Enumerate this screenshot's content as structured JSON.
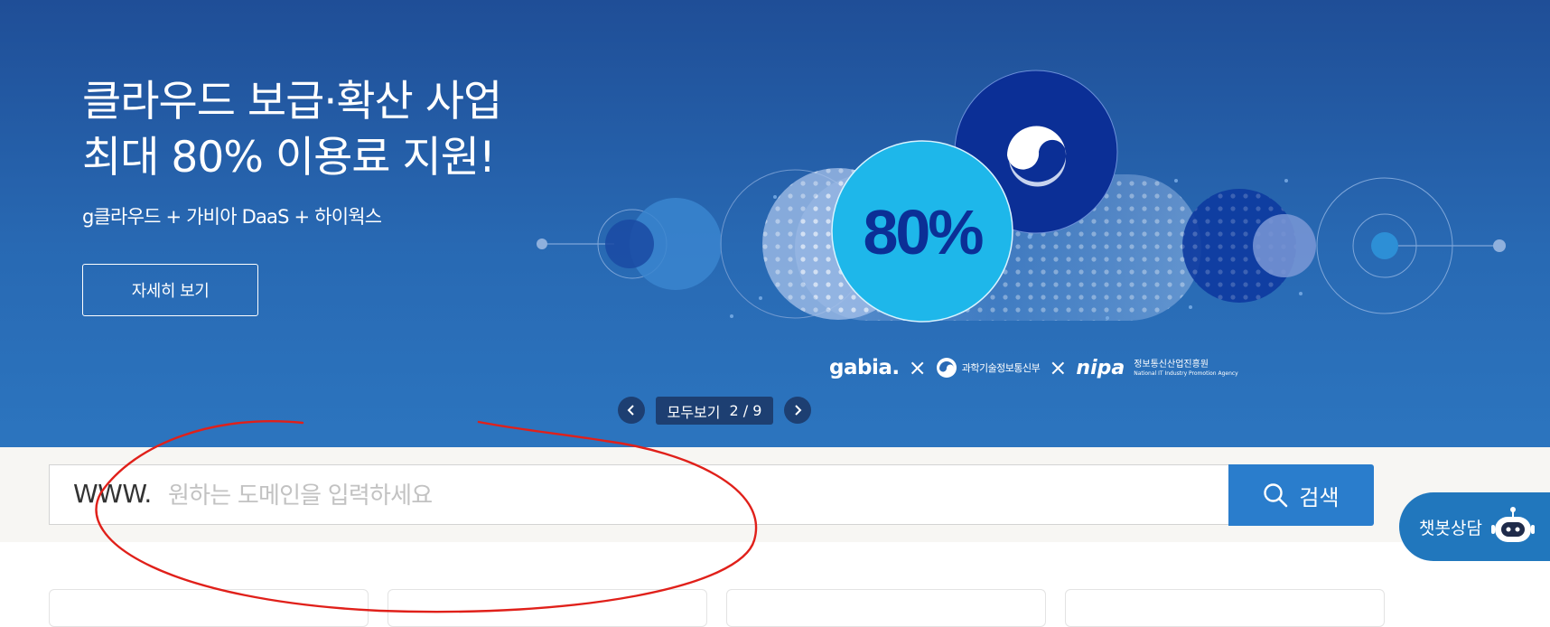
{
  "hero": {
    "title_line1": "클라우드 보급·확산 사업",
    "title_line2": "최대 80% 이용료 지원!",
    "subtitle": "g클라우드 + 가비아 DaaS + 하이웍스",
    "detail_button": "자세히 보기",
    "badge_text": "80%",
    "partners": {
      "gabia": "gabia.",
      "separator": "×",
      "msit": "과학기술정보통신부",
      "nipa": "nipa",
      "nipa_kr": "정보통신산업진흥원",
      "nipa_en": "National IT Industry Promotion Agency"
    }
  },
  "pager": {
    "view_all": "모두보기",
    "counter": "2 / 9",
    "current": 2,
    "total": 9
  },
  "domain_search": {
    "prefix": "WWW.",
    "placeholder": "원하는 도메인을 입력하세요",
    "value": "",
    "button_label": "검색"
  },
  "chatbot": {
    "label": "챗봇상담"
  },
  "colors": {
    "hero_top": "#1f4e97",
    "hero_bottom": "#2c75bf",
    "search_button": "#2a7dcc",
    "chatbot": "#2177bd",
    "annotation": "#e0201a"
  },
  "icons": [
    "chevron-left-icon",
    "chevron-right-icon",
    "search-icon",
    "robot-icon",
    "msit-emblem-icon"
  ]
}
